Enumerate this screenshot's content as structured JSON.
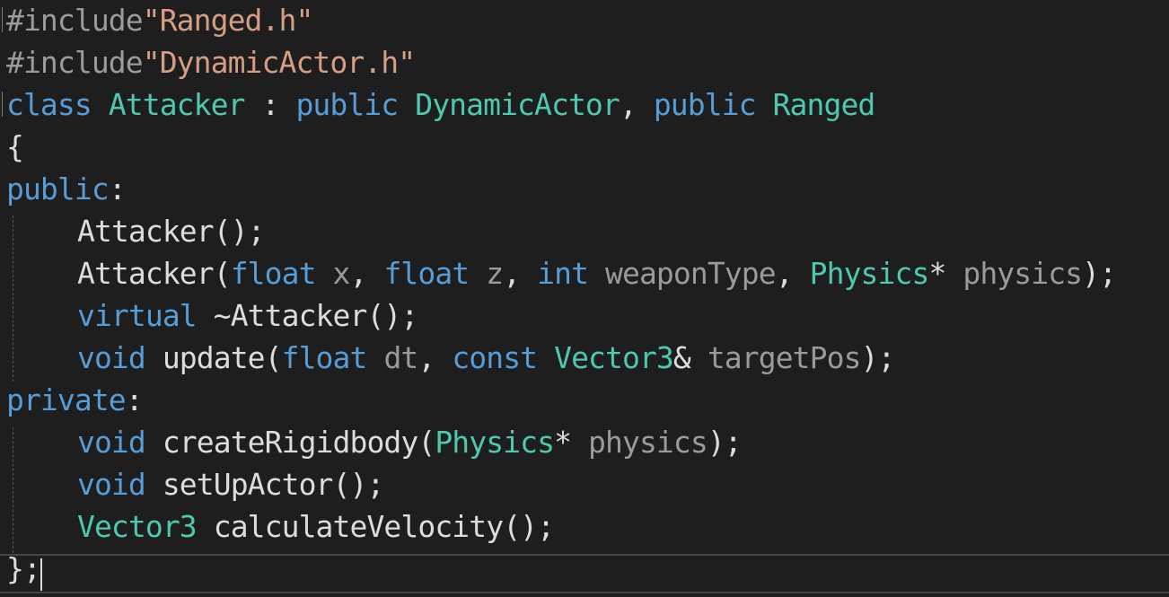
{
  "editor": {
    "lines": [
      {
        "tokens": [
          {
            "text": "#include",
            "cls": "tok-directive"
          },
          {
            "text": "\"Ranged.h\"",
            "cls": "tok-string"
          }
        ]
      },
      {
        "tokens": [
          {
            "text": "#include",
            "cls": "tok-directive"
          },
          {
            "text": "\"DynamicActor.h\"",
            "cls": "tok-string"
          }
        ]
      },
      {
        "tokens": [
          {
            "text": "class",
            "cls": "tok-keyword"
          },
          {
            "text": " ",
            "cls": "tok-plain"
          },
          {
            "text": "Attacker",
            "cls": "tok-type"
          },
          {
            "text": " : ",
            "cls": "tok-plain"
          },
          {
            "text": "public",
            "cls": "tok-keyword"
          },
          {
            "text": " ",
            "cls": "tok-plain"
          },
          {
            "text": "DynamicActor",
            "cls": "tok-type"
          },
          {
            "text": ", ",
            "cls": "tok-plain"
          },
          {
            "text": "public",
            "cls": "tok-keyword"
          },
          {
            "text": " ",
            "cls": "tok-plain"
          },
          {
            "text": "Ranged",
            "cls": "tok-type"
          }
        ]
      },
      {
        "tokens": [
          {
            "text": "{",
            "cls": "tok-plain"
          }
        ]
      },
      {
        "tokens": [
          {
            "text": "public",
            "cls": "tok-keyword"
          },
          {
            "text": ":",
            "cls": "tok-plain"
          }
        ]
      },
      {
        "indent": true,
        "tokens": [
          {
            "text": "Attacker();",
            "cls": "tok-plain"
          }
        ]
      },
      {
        "indent": true,
        "tokens": [
          {
            "text": "Attacker(",
            "cls": "tok-plain"
          },
          {
            "text": "float",
            "cls": "tok-keyword"
          },
          {
            "text": " ",
            "cls": "tok-plain"
          },
          {
            "text": "x",
            "cls": "tok-param"
          },
          {
            "text": ", ",
            "cls": "tok-plain"
          },
          {
            "text": "float",
            "cls": "tok-keyword"
          },
          {
            "text": " ",
            "cls": "tok-plain"
          },
          {
            "text": "z",
            "cls": "tok-param"
          },
          {
            "text": ", ",
            "cls": "tok-plain"
          },
          {
            "text": "int",
            "cls": "tok-keyword"
          },
          {
            "text": " ",
            "cls": "tok-plain"
          },
          {
            "text": "weaponType",
            "cls": "tok-param"
          },
          {
            "text": ", ",
            "cls": "tok-plain"
          },
          {
            "text": "Physics",
            "cls": "tok-type"
          },
          {
            "text": "* ",
            "cls": "tok-plain"
          },
          {
            "text": "physics",
            "cls": "tok-param"
          },
          {
            "text": ");",
            "cls": "tok-plain"
          }
        ]
      },
      {
        "indent": true,
        "tokens": [
          {
            "text": "virtual",
            "cls": "tok-keyword"
          },
          {
            "text": " ~Attacker();",
            "cls": "tok-plain"
          }
        ]
      },
      {
        "indent": true,
        "tokens": [
          {
            "text": "void",
            "cls": "tok-keyword"
          },
          {
            "text": " update(",
            "cls": "tok-plain"
          },
          {
            "text": "float",
            "cls": "tok-keyword"
          },
          {
            "text": " ",
            "cls": "tok-plain"
          },
          {
            "text": "dt",
            "cls": "tok-param"
          },
          {
            "text": ", ",
            "cls": "tok-plain"
          },
          {
            "text": "const",
            "cls": "tok-keyword"
          },
          {
            "text": " ",
            "cls": "tok-plain"
          },
          {
            "text": "Vector3",
            "cls": "tok-type"
          },
          {
            "text": "& ",
            "cls": "tok-plain"
          },
          {
            "text": "targetPos",
            "cls": "tok-param"
          },
          {
            "text": ");",
            "cls": "tok-plain"
          }
        ]
      },
      {
        "tokens": [
          {
            "text": "private",
            "cls": "tok-keyword"
          },
          {
            "text": ":",
            "cls": "tok-plain"
          }
        ]
      },
      {
        "indent": true,
        "tokens": [
          {
            "text": "void",
            "cls": "tok-keyword"
          },
          {
            "text": " createRigidbody(",
            "cls": "tok-plain"
          },
          {
            "text": "Physics",
            "cls": "tok-type"
          },
          {
            "text": "* ",
            "cls": "tok-plain"
          },
          {
            "text": "physics",
            "cls": "tok-param"
          },
          {
            "text": ");",
            "cls": "tok-plain"
          }
        ]
      },
      {
        "indent": true,
        "tokens": [
          {
            "text": "void",
            "cls": "tok-keyword"
          },
          {
            "text": " setUpActor();",
            "cls": "tok-plain"
          }
        ]
      },
      {
        "indent": true,
        "tokens": [
          {
            "text": "Vector3",
            "cls": "tok-type"
          },
          {
            "text": " calculateVelocity();",
            "cls": "tok-plain"
          }
        ]
      },
      {
        "tokens": [
          {
            "text": "};",
            "cls": "tok-plain"
          }
        ]
      }
    ]
  },
  "colors": {
    "background": "#1e1e1e",
    "keyword": "#569cd6",
    "type": "#4ec9b0",
    "string": "#d69d85",
    "plain": "#dcdcdc",
    "parameter": "#9a9a9a",
    "directive": "#9b9b9b"
  }
}
